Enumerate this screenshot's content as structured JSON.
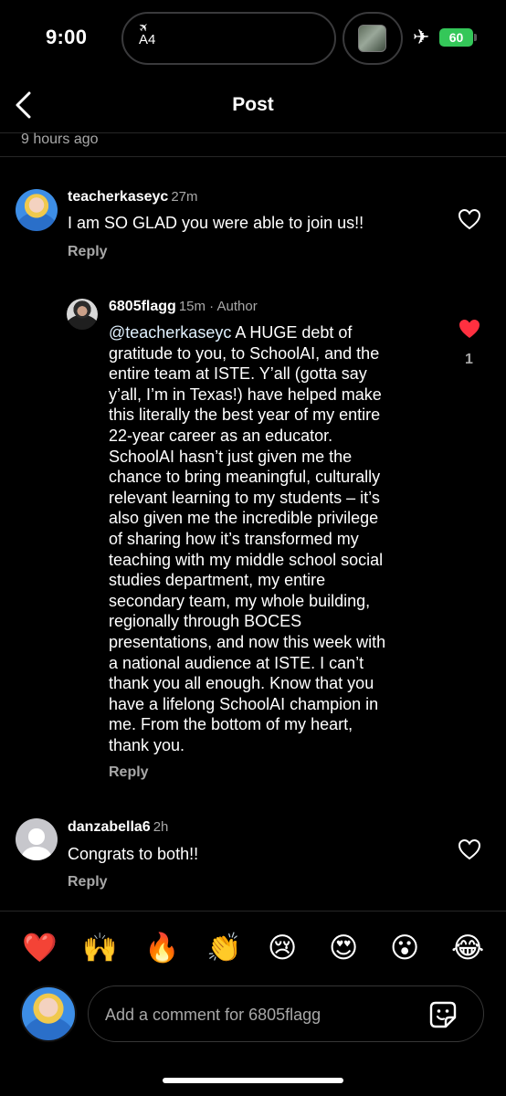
{
  "status_bar": {
    "time": "9:00",
    "flight_label": "A4",
    "battery": "60",
    "icons": [
      "plane-icon",
      "album-art",
      "airplane-mode-icon",
      "battery-icon"
    ]
  },
  "header": {
    "title": "Post",
    "back_icon": "chevron-left-icon"
  },
  "post": {
    "time_ago": "9 hours ago"
  },
  "comments": [
    {
      "username": "teacherkaseyc",
      "time": "27m",
      "text": "I am SO GLAD you were able to join us!!",
      "reply_label": "Reply",
      "liked": false
    },
    {
      "username": "6805flagg",
      "time": "15m · Author",
      "mention": "@teacherkaseyc",
      "lines": [
        " A HUGE debt of",
        "gratitude to you, to SchoolAI, and the",
        "entire team at ISTE. Y’all (gotta say",
        "y’all, I’m in Texas!) have helped make",
        "this literally the best year of my entire",
        "22-year career as an educator.",
        "SchoolAI hasn’t just given me the",
        "chance to bring meaningful, culturally",
        "relevant learning to my students – it’s",
        "also given me the incredible privilege",
        "of sharing how it’s transformed my",
        "teaching with my middle school social",
        "studies department, my entire",
        "secondary team, my whole building,",
        "regionally through BOCES",
        "presentations, and now this week with",
        "a national audience at ISTE. I can’t",
        "thank you all enough. Know that you",
        "have a lifelong SchoolAI champion in",
        "me. From the bottom of my heart,",
        "thank you."
      ],
      "reply_label": "Reply",
      "liked": true,
      "like_count": "1"
    },
    {
      "username": "danzabella6",
      "time": "2h",
      "text": "Congrats to both!!",
      "reply_label": "Reply",
      "liked": false
    }
  ],
  "emoji_bar": [
    "❤️",
    "🙌",
    "🔥",
    "👏",
    "😢",
    "😍",
    "😮",
    "😂"
  ],
  "compose": {
    "placeholder": "Add a comment for 6805flagg"
  },
  "colors": {
    "background": "#000000",
    "secondary_text": "#a8a8a8",
    "like_red": "#ff3040",
    "battery_green": "#34c759"
  }
}
